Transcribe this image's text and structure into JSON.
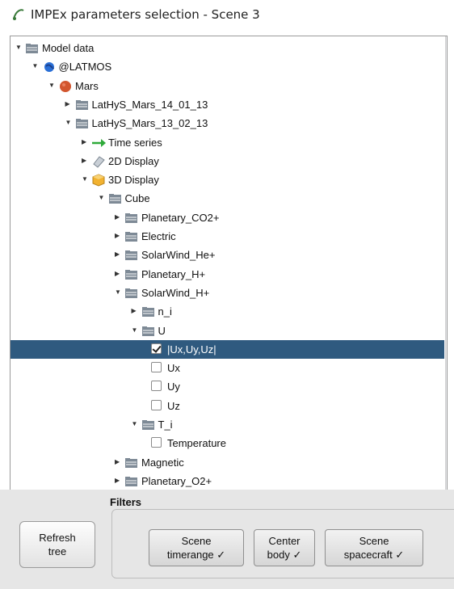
{
  "window": {
    "title": "IMPEx parameters selection - Scene 3"
  },
  "tree": {
    "rows": [
      {
        "label": "Model data",
        "depth": 0,
        "expanded": true,
        "icon": "folder-open-icon"
      },
      {
        "label": "@LATMOS",
        "depth": 1,
        "expanded": true,
        "icon": "earth-icon"
      },
      {
        "label": "Mars",
        "depth": 2,
        "expanded": true,
        "icon": "mars-planet-icon"
      },
      {
        "label": "LatHyS_Mars_14_01_13",
        "depth": 3,
        "expanded": false,
        "icon": "folder-icon"
      },
      {
        "label": "LatHyS_Mars_13_02_13",
        "depth": 3,
        "expanded": true,
        "icon": "folder-open-icon"
      },
      {
        "label": "Time series",
        "depth": 4,
        "expanded": false,
        "icon": "arrow-right-icon"
      },
      {
        "label": "2D Display",
        "depth": 4,
        "expanded": false,
        "icon": "plane-icon"
      },
      {
        "label": "3D Display",
        "depth": 4,
        "expanded": true,
        "icon": "cube-icon"
      },
      {
        "label": "Cube",
        "depth": 5,
        "expanded": true,
        "icon": "folder-open-icon"
      },
      {
        "label": "Planetary_CO2+",
        "depth": 6,
        "expanded": false,
        "icon": "folder-icon"
      },
      {
        "label": "Electric",
        "depth": 6,
        "expanded": false,
        "icon": "folder-icon"
      },
      {
        "label": "SolarWind_He+",
        "depth": 6,
        "expanded": false,
        "icon": "folder-icon"
      },
      {
        "label": "Planetary_H+",
        "depth": 6,
        "expanded": false,
        "icon": "folder-icon"
      },
      {
        "label": "SolarWind_H+",
        "depth": 6,
        "expanded": true,
        "icon": "folder-open-icon"
      },
      {
        "label": "n_i",
        "depth": 7,
        "expanded": false,
        "icon": "folder-icon"
      },
      {
        "label": "U",
        "depth": 7,
        "expanded": true,
        "icon": "folder-open-icon"
      },
      {
        "label": "|Ux,Uy,Uz|",
        "depth": 8,
        "checkbox": true,
        "checked": true,
        "selected": true
      },
      {
        "label": "Ux",
        "depth": 8,
        "checkbox": true,
        "checked": false
      },
      {
        "label": "Uy",
        "depth": 8,
        "checkbox": true,
        "checked": false
      },
      {
        "label": "Uz",
        "depth": 8,
        "checkbox": true,
        "checked": false
      },
      {
        "label": "T_i",
        "depth": 7,
        "expanded": true,
        "icon": "folder-open-icon"
      },
      {
        "label": "Temperature",
        "depth": 8,
        "checkbox": true,
        "checked": false
      },
      {
        "label": "Magnetic",
        "depth": 6,
        "expanded": false,
        "icon": "folder-icon"
      },
      {
        "label": "Planetary_O2+",
        "depth": 6,
        "expanded": false,
        "icon": "folder-icon"
      }
    ]
  },
  "bottom": {
    "filters_label": "Filters",
    "refresh_label": "Refresh\ntree",
    "filters": [
      {
        "label": "Scene\ntimerange ✓"
      },
      {
        "label": "Center\nbody ✓"
      },
      {
        "label": "Scene\nspacecraft ✓"
      }
    ]
  },
  "colors": {
    "selection": "#2f5a7f",
    "folder": "#7e8a96",
    "mars": "#d2552e",
    "cube": "#f2b230"
  }
}
